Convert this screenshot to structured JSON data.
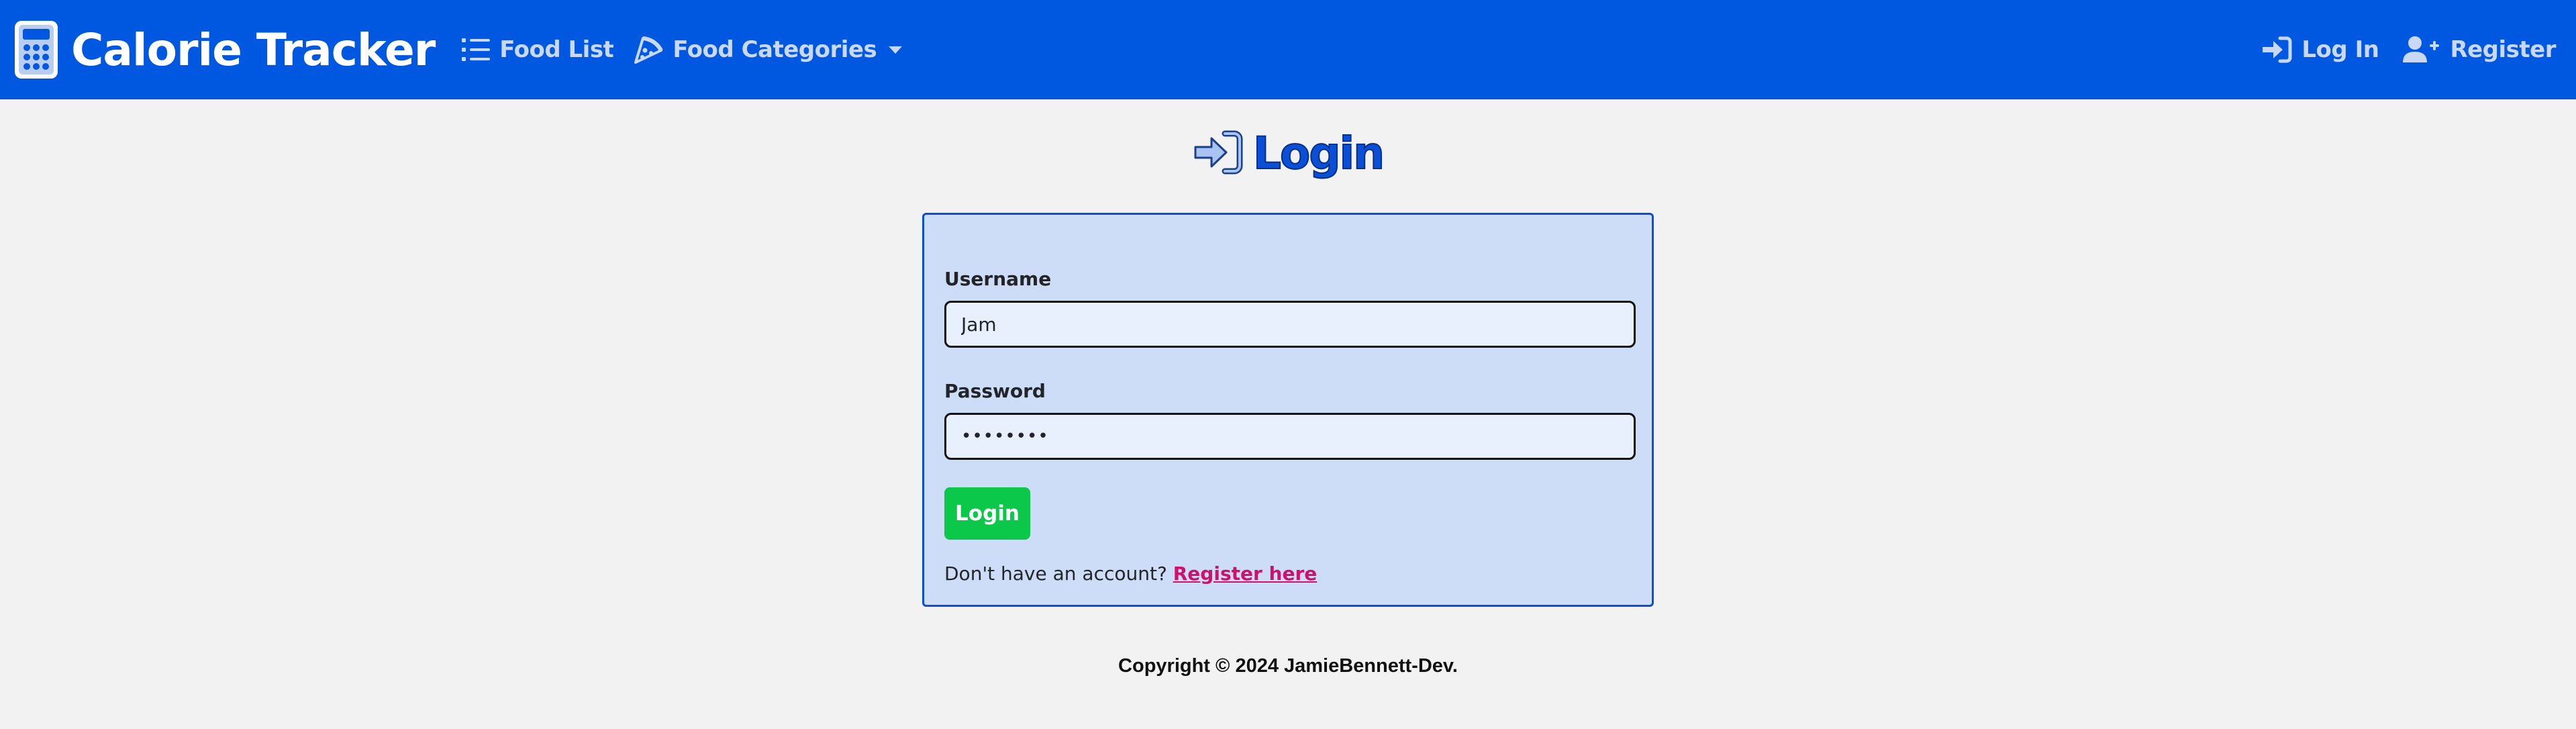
{
  "navbar": {
    "brand": "Calorie Tracker",
    "brand_icon": "calculator-icon",
    "links": [
      {
        "label": "Food List",
        "icon": "list-icon"
      },
      {
        "label": "Food Categories",
        "icon": "pizza-icon",
        "dropdown": true
      }
    ],
    "right_links": [
      {
        "label": "Log In",
        "icon": "sign-in-icon"
      },
      {
        "label": "Register",
        "icon": "user-plus-icon"
      }
    ]
  },
  "page": {
    "title": "Login",
    "title_icon": "sign-in-icon"
  },
  "form": {
    "username_label": "Username",
    "username_value": "Jam",
    "password_label": "Password",
    "password_value": "••••••••",
    "submit_label": "Login",
    "register_prompt": "Don't have an account?",
    "register_link": "Register here"
  },
  "footer": {
    "copyright": "Copyright © 2024 JamieBennett-Dev."
  },
  "colors": {
    "navbar": "#0057e0",
    "background": "#f2f2f2",
    "card": "#cddcf7",
    "accent": "#0a4fd6",
    "submit": "#0bc74a",
    "link": "#d0106a"
  }
}
